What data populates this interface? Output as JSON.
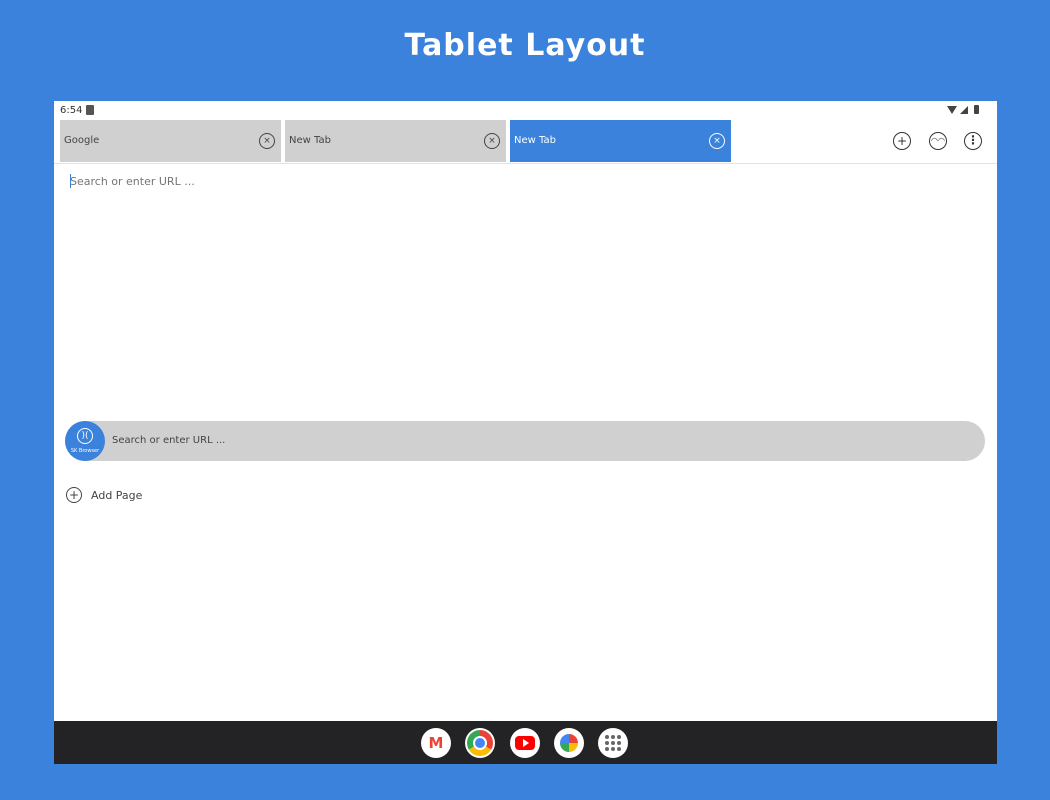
{
  "banner": {
    "title": "Tablet Layout"
  },
  "status_bar": {
    "time": "6:54"
  },
  "tabs": [
    {
      "label": "Google",
      "active": false
    },
    {
      "label": "New Tab",
      "active": false
    },
    {
      "label": "New Tab",
      "active": true
    }
  ],
  "toolbar": {
    "new_tab_icon": "plus-icon",
    "incognito_icon": "incognito-icon",
    "menu_icon": "more-vert-icon"
  },
  "url_bar": {
    "placeholder": "Search or enter URL ..."
  },
  "search_pill": {
    "logo_text": "SK Browser",
    "placeholder": "Search or enter URL ..."
  },
  "add_page": {
    "label": "Add Page"
  },
  "dock": {
    "apps": [
      "gmail-icon",
      "chrome-icon",
      "youtube-icon",
      "photos-icon",
      "app-drawer-icon"
    ]
  },
  "colors": {
    "accent": "#3a82dc",
    "tab_inactive": "#d0d0d0",
    "dock": "#232326"
  }
}
